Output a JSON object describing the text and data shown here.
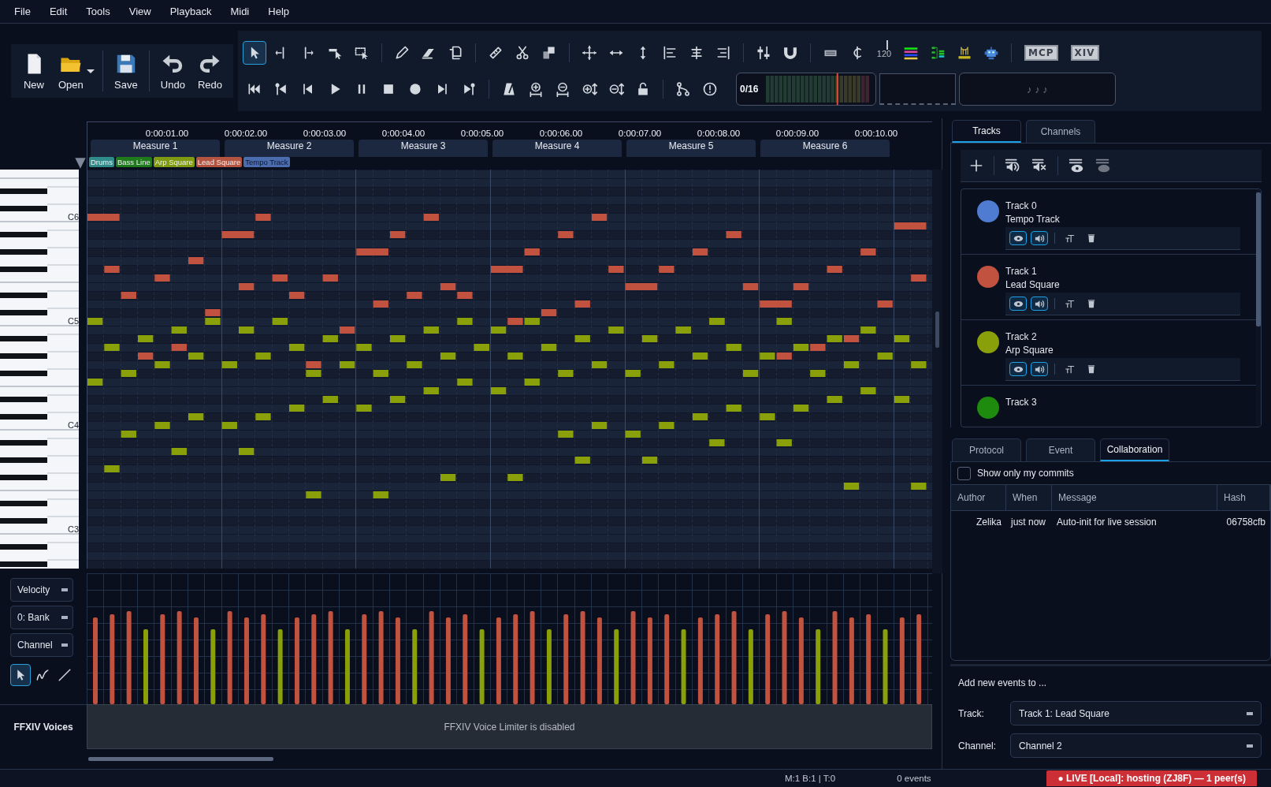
{
  "menu": [
    "File",
    "Edit",
    "Tools",
    "View",
    "Playback",
    "Midi",
    "Help"
  ],
  "file_toolbar": [
    {
      "label": "New",
      "kind": "new",
      "dropdown": false
    },
    {
      "label": "Open",
      "kind": "open",
      "dropdown": true
    },
    {
      "label": "Save",
      "kind": "save",
      "dropdown": false
    },
    {
      "label": "Undo",
      "kind": "undo",
      "dropdown": false
    },
    {
      "label": "Redo",
      "kind": "redo",
      "dropdown": false
    }
  ],
  "edit_tools": [
    {
      "selected": true
    },
    {
      "selected": false
    },
    {
      "selected": false
    },
    {
      "selected": false
    },
    {
      "selected": false
    }
  ],
  "tempo_icon_text": "120",
  "text_buttons": [
    "MCP",
    "XIV"
  ],
  "voice_meter": {
    "label": "0/16"
  },
  "note_display": "♪ ♪ ♪",
  "timeline": {
    "times": [
      "0:00:01.00",
      "0:00:02.00",
      "0:00:03.00",
      "0:00:04.00",
      "0:00:05.00",
      "0:00:06.00",
      "0:00:07.00",
      "0:00:08.00",
      "0:00:09.00",
      "0:00:10.00"
    ],
    "measures": [
      "Measure 1",
      "Measure 2",
      "Measure 3",
      "Measure 4",
      "Measure 5",
      "Measure 6"
    ],
    "track_chips": [
      {
        "label": "Drums",
        "color": "#2f8c8a"
      },
      {
        "label": "Bass Line",
        "color": "#1f7a1c"
      },
      {
        "label": "Arp Square",
        "color": "#7f9a10"
      },
      {
        "label": "Lead Square",
        "color": "#b4533f"
      },
      {
        "label": "Tempo Track",
        "color": "#4b6db0"
      }
    ]
  },
  "octave_labels": [
    "C6",
    "C5",
    "C4",
    "C3"
  ],
  "velocity_panel": {
    "selectors": [
      "Velocity",
      "0: Bank",
      "Channel"
    ],
    "tools": [
      {
        "selected": true
      },
      {
        "selected": false
      },
      {
        "selected": false
      }
    ]
  },
  "voice_limiter": {
    "label": "FFXIV Voices",
    "message": "FFXIV Voice Limiter is disabled"
  },
  "tracks_panel": {
    "tabs": [
      {
        "label": "Tracks",
        "selected": true
      },
      {
        "label": "Channels",
        "selected": false
      }
    ],
    "tracks": [
      {
        "number": "Track 0",
        "name": "Tempo Track",
        "color": "#4f7bd0",
        "visible": true,
        "audible": true
      },
      {
        "number": "Track 1",
        "name": "Lead Square",
        "color": "#c0523f",
        "visible": true,
        "audible": true
      },
      {
        "number": "Track 2",
        "name": "Arp Square",
        "color": "#8aa00a",
        "visible": true,
        "audible": true
      },
      {
        "number": "Track 3",
        "color": "#1e8a0e"
      }
    ]
  },
  "details_panel": {
    "tabs": [
      {
        "label": "Protocol",
        "selected": false
      },
      {
        "label": "Event",
        "selected": false
      },
      {
        "label": "Collaboration",
        "selected": true
      }
    ],
    "filter": {
      "label": "Show only my commits",
      "checked": false
    },
    "table": {
      "columns": [
        "Author",
        "When",
        "Message",
        "Hash"
      ],
      "rows": [
        [
          "Zelika",
          "just now",
          "Auto-init for live session",
          "06758cfb"
        ]
      ]
    }
  },
  "add_events": {
    "title": "Add new events to ...",
    "fields": [
      {
        "label": "Track:",
        "value": "Track 1: Lead Square"
      },
      {
        "label": "Channel:",
        "value": "Channel 2"
      }
    ]
  },
  "status_bar": {
    "position": "M:1 B:1 | T:0",
    "events": "0 events",
    "live": "● LIVE [Local]: hosting (ZJ8F) — 1 peer(s)"
  }
}
